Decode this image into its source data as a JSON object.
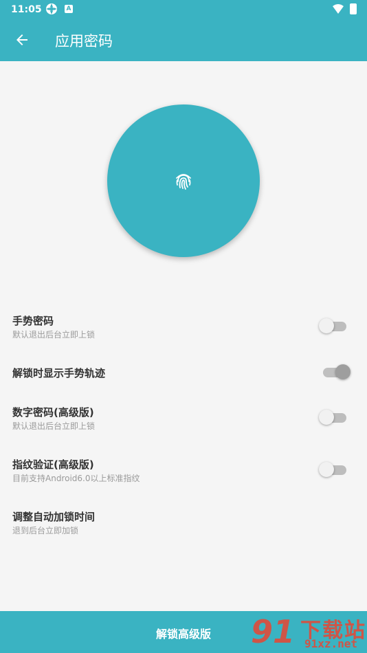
{
  "status_bar": {
    "time": "11:05",
    "badge": "A"
  },
  "header": {
    "title": "应用密码"
  },
  "fingerprint": {
    "icon": "fingerprint-icon"
  },
  "settings": [
    {
      "title": "手势密码",
      "subtitle": "默认退出后台立即上锁",
      "switch": "off"
    },
    {
      "title": "解锁时显示手势轨迹",
      "subtitle": "",
      "switch": "on"
    },
    {
      "title": "数字密码(高级版)",
      "subtitle": "默认退出后台立即上锁",
      "switch": "off"
    },
    {
      "title": "指纹验证(高级版)",
      "subtitle": "目前支持Android6.0以上标准指纹",
      "switch": "off"
    },
    {
      "title": "调整自动加锁时间",
      "subtitle": "退到后台立即加锁"
    }
  ],
  "bottom_bar": {
    "label": "解锁高级版"
  },
  "watermark": {
    "logo": "91",
    "brand": "下载站",
    "url": "91xz.net"
  },
  "colors": {
    "primary": "#3ab3c2",
    "background": "#f5f5f5"
  }
}
